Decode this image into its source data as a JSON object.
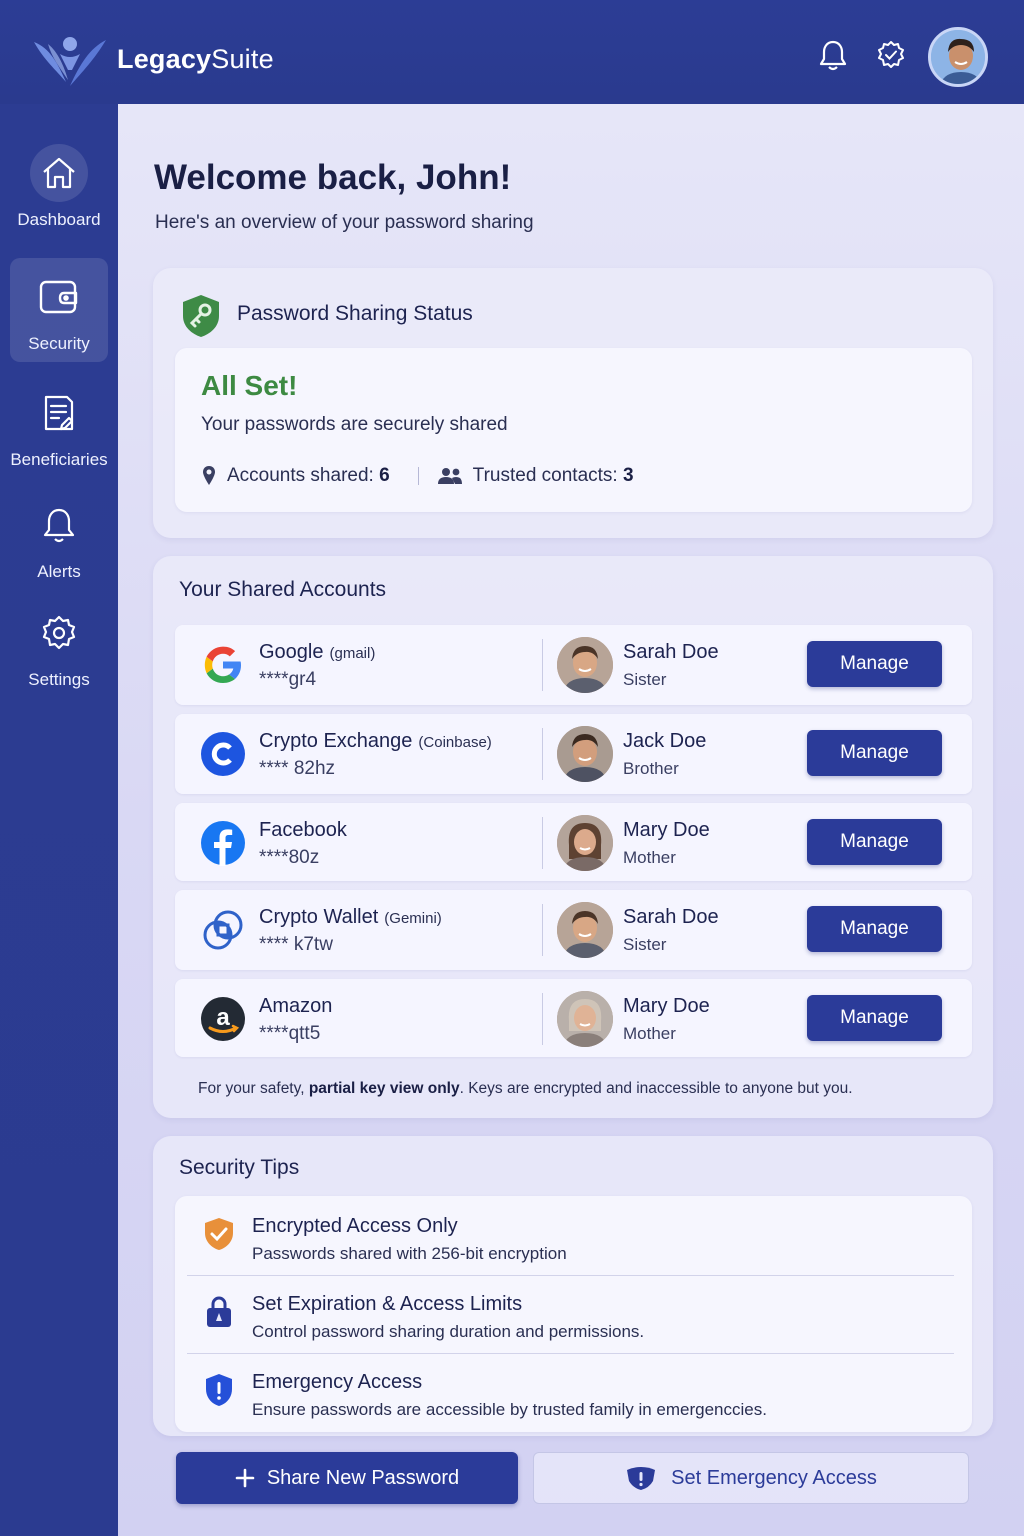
{
  "app": {
    "brand_bold": "Legacy",
    "brand_thin": "Suite"
  },
  "header": {
    "icons": [
      "bell-icon",
      "gear-icon",
      "user-avatar"
    ]
  },
  "sidebar": {
    "items": [
      {
        "label": "Dashboard",
        "icon": "home-icon"
      },
      {
        "label": "Security",
        "icon": "wallet-icon",
        "active": true
      },
      {
        "label": "Beneficiaries",
        "icon": "document-icon"
      },
      {
        "label": "Alerts",
        "icon": "bell-icon"
      },
      {
        "label": "Settings",
        "icon": "gear-icon"
      }
    ]
  },
  "main": {
    "welcome": "Welcome back, John!",
    "subtitle": "Here's an overview of your password sharing"
  },
  "status": {
    "title": "Password Sharing Status",
    "headline": "All Set!",
    "message": "Your passwords are securely shared",
    "accounts_label": "Accounts shared:",
    "accounts_count": "6",
    "contacts_label": "Trusted contacts:",
    "contacts_count": "3"
  },
  "accounts": {
    "title": "Your Shared Accounts",
    "manage_label": "Manage",
    "rows": [
      {
        "name": "Google",
        "provider": "(gmail)",
        "key": "****gr4",
        "person": "Sarah Doe",
        "relation": "Sister",
        "logo": "google-logo"
      },
      {
        "name": "Crypto Exchange",
        "provider": "(Coinbase)",
        "key": "**** 82hz",
        "person": "Jack Doe",
        "relation": "Brother",
        "logo": "coinbase-logo"
      },
      {
        "name": "Facebook",
        "provider": "",
        "key": "****80z",
        "person": "Mary Doe",
        "relation": "Mother",
        "logo": "facebook-logo"
      },
      {
        "name": "Crypto Wallet",
        "provider": "(Gemini)",
        "key": "**** k7tw",
        "person": "Sarah Doe",
        "relation": "Sister",
        "logo": "gemini-logo"
      },
      {
        "name": "Amazon",
        "provider": "",
        "key": "****qtt5",
        "person": "Mary Doe",
        "relation": "Mother",
        "logo": "amazon-logo"
      }
    ],
    "footnote_pre": "For your safety, ",
    "footnote_bold": "partial key view only",
    "footnote_post": ". Keys are encrypted and inaccessible to anyone but you."
  },
  "tips": {
    "title": "Security Tips",
    "items": [
      {
        "title": "Encrypted Access Only",
        "desc": "Passwords shared with 256-bit encryption",
        "icon": "shield-check-icon"
      },
      {
        "title": "Set Expiration & Access Limits",
        "desc": "Control password sharing duration and permissions.",
        "icon": "lock-icon"
      },
      {
        "title": "Emergency Access",
        "desc": "Ensure passwords are accessible by trusted family in emergenccies.",
        "icon": "shield-alert-icon"
      }
    ]
  },
  "actions": {
    "share_label": "Share New Password",
    "emergency_label": "Set Emergency Access"
  },
  "colors": {
    "primary": "#2b3b99",
    "success": "#3d8a42",
    "sidebar": "#2c3c92"
  }
}
